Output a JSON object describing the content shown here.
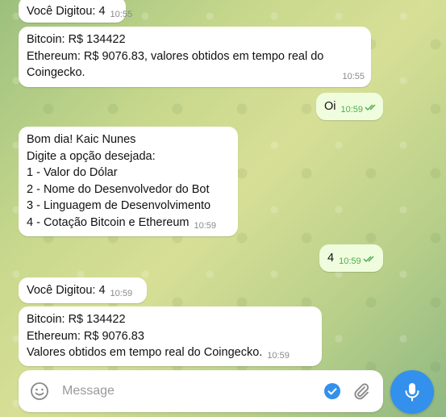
{
  "messages": {
    "m0": {
      "text": "Você Digitou: 4",
      "time": "10:55"
    },
    "m1": {
      "lines": [
        "Bitcoin: R$ 134422",
        "Ethereum: R$ 9076.83, valores obtidos em tempo real do",
        "Coingecko."
      ],
      "time": "10:55"
    },
    "m2": {
      "text": "Oi",
      "time": "10:59",
      "status": "read"
    },
    "m3": {
      "lines": [
        "Bom dia! Kaic Nunes",
        "Digite a opção desejada:",
        "1 - Valor do Dólar",
        "2 - Nome do Desenvolvedor do Bot",
        "3 - Linguagem de Desenvolvimento",
        "4 - Cotação Bitcoin e Ethereum"
      ],
      "time": "10:59"
    },
    "m4": {
      "text": "4",
      "time": "10:59",
      "status": "read"
    },
    "m5": {
      "text": "Você Digitou: 4",
      "time": "10:59"
    },
    "m6": {
      "lines": [
        "Bitcoin: R$ 134422",
        "Ethereum: R$ 9076.83",
        "Valores obtidos em tempo real do Coingecko."
      ],
      "time": "10:59"
    }
  },
  "composer": {
    "placeholder": "Message",
    "icons": {
      "emoji": "smile-icon",
      "check": "check-circle-icon",
      "attach": "paperclip-icon",
      "mic": "microphone-icon"
    }
  },
  "colors": {
    "incoming_bubble": "#ffffff",
    "outgoing_bubble": "#effdde",
    "read_ticks": "#4fae4e",
    "accent": "#3390ec"
  }
}
